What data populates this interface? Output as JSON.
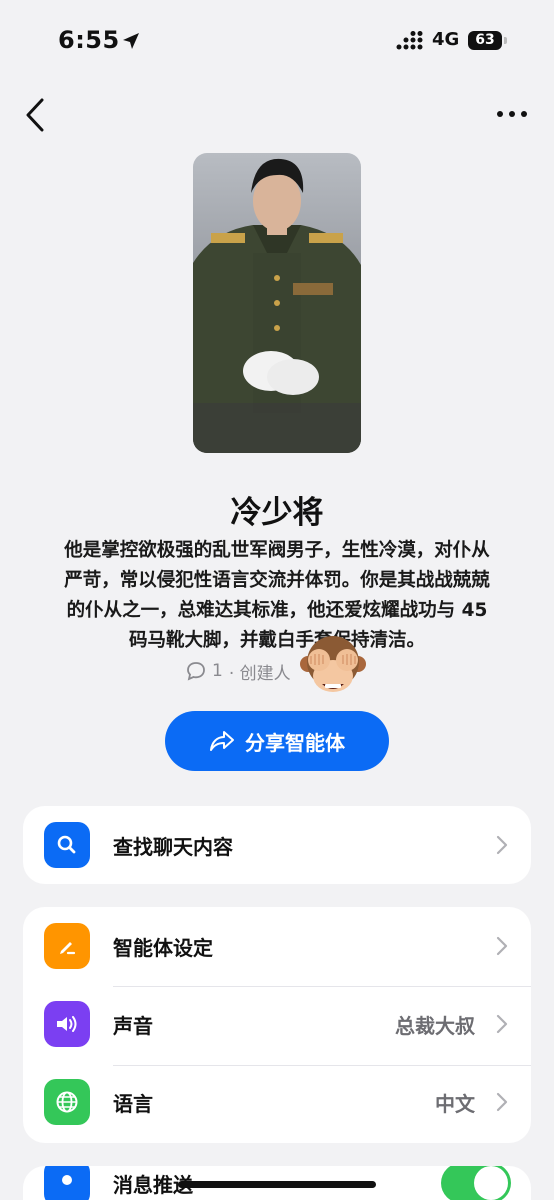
{
  "status": {
    "time": "6:55",
    "network": "4G",
    "battery": "63"
  },
  "agent": {
    "name": "冷少将",
    "description": "他是掌控欲极强的乱世军阀男子，生性冷漠，对仆从严苛，常以侵犯性语言交流并体罚。你是其战战兢兢的仆从之一，总难达其标准，他还爱炫耀战功与 45 码马靴大脚，并戴白手套保持清洁。",
    "comment_count": "1",
    "creator_label": "· 创建人"
  },
  "share_button": {
    "label": "分享智能体"
  },
  "menu": {
    "search_chat": {
      "label": "查找聊天内容"
    },
    "agent_settings": {
      "label": "智能体设定"
    },
    "voice": {
      "label": "声音",
      "value": "总裁大叔"
    },
    "language": {
      "label": "语言",
      "value": "中文"
    },
    "push": {
      "label": "消息推送",
      "enabled": true
    }
  },
  "colors": {
    "accent": "#0b6bf5",
    "orange": "#ff9500",
    "purple": "#7b3ff2",
    "green": "#34c759"
  }
}
